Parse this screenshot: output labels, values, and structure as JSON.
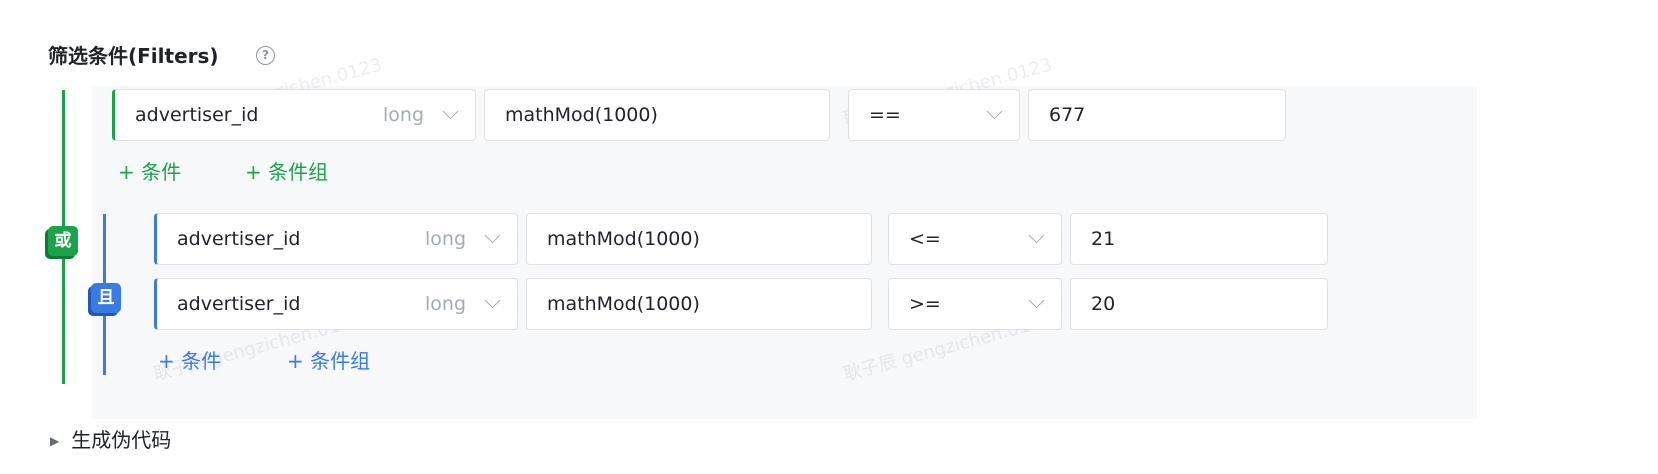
{
  "header": {
    "title": "筛选条件(Filters)",
    "help_glyph": "?"
  },
  "groups": {
    "or_label": "或",
    "and_label": "且",
    "outer_row": {
      "field": "advertiser_id",
      "type": "long",
      "function": "mathMod(1000)",
      "operator": "==",
      "value": "677"
    },
    "outer_actions": {
      "add_condition": "+ 条件",
      "add_group": "+ 条件组"
    },
    "inner_rows": [
      {
        "field": "advertiser_id",
        "type": "long",
        "function": "mathMod(1000)",
        "operator": "<=",
        "value": "21"
      },
      {
        "field": "advertiser_id",
        "type": "long",
        "function": "mathMod(1000)",
        "operator": ">=",
        "value": "20"
      }
    ],
    "inner_actions": {
      "add_condition": "+ 条件",
      "add_group": "+ 条件组"
    }
  },
  "footer": {
    "generate_pseudocode": "生成伪代码",
    "expand_icon": "triangle-right-icon"
  },
  "watermark": {
    "text": "耿子辰 gengzichen.0123"
  },
  "colors": {
    "or_green": "#1ba34b",
    "and_blue": "#3a7ae3",
    "panel_bg": "#f7f8fa",
    "border": "#dee0e3",
    "muted": "#a5abb3"
  }
}
